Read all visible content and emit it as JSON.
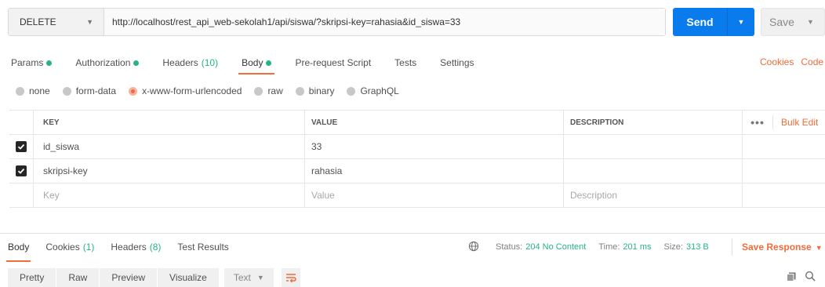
{
  "request": {
    "method": "DELETE",
    "url": "http://localhost/rest_api_web-sekolah1/api/siswa/?skripsi-key=rahasia&id_siswa=33",
    "send_label": "Send",
    "save_label": "Save"
  },
  "tabs": [
    {
      "label": "Params",
      "dot": true
    },
    {
      "label": "Authorization",
      "dot": true
    },
    {
      "label": "Headers",
      "count": "(10)"
    },
    {
      "label": "Body",
      "dot": true,
      "active": true
    },
    {
      "label": "Pre-request Script"
    },
    {
      "label": "Tests"
    },
    {
      "label": "Settings"
    }
  ],
  "links": {
    "cookies": "Cookies",
    "code": "Code"
  },
  "body_types": [
    {
      "label": "none",
      "selected": false
    },
    {
      "label": "form-data",
      "selected": false
    },
    {
      "label": "x-www-form-urlencoded",
      "selected": true
    },
    {
      "label": "raw",
      "selected": false
    },
    {
      "label": "binary",
      "selected": false
    },
    {
      "label": "GraphQL",
      "selected": false
    }
  ],
  "table": {
    "headers": {
      "key": "KEY",
      "value": "VALUE",
      "description": "DESCRIPTION"
    },
    "more": "•••",
    "bulk_edit": "Bulk Edit",
    "rows": [
      {
        "key": "id_siswa",
        "value": "33",
        "description": "",
        "checked": true
      },
      {
        "key": "skripsi-key",
        "value": "rahasia",
        "description": "",
        "checked": true
      }
    ],
    "placeholders": {
      "key": "Key",
      "value": "Value",
      "description": "Description"
    }
  },
  "response": {
    "tabs": [
      {
        "label": "Body",
        "active": true
      },
      {
        "label": "Cookies",
        "count": "(1)"
      },
      {
        "label": "Headers",
        "count": "(8)"
      },
      {
        "label": "Test Results"
      }
    ],
    "status_label": "Status:",
    "status": "204 No Content",
    "time_label": "Time:",
    "time": "201 ms",
    "size_label": "Size:",
    "size": "313 B",
    "save_response": "Save Response",
    "view_modes": [
      "Pretty",
      "Raw",
      "Preview",
      "Visualize"
    ],
    "format": "Text"
  },
  "colors": {
    "accent": "#f26b3a",
    "send": "#097bed",
    "green": "#26b47f"
  }
}
